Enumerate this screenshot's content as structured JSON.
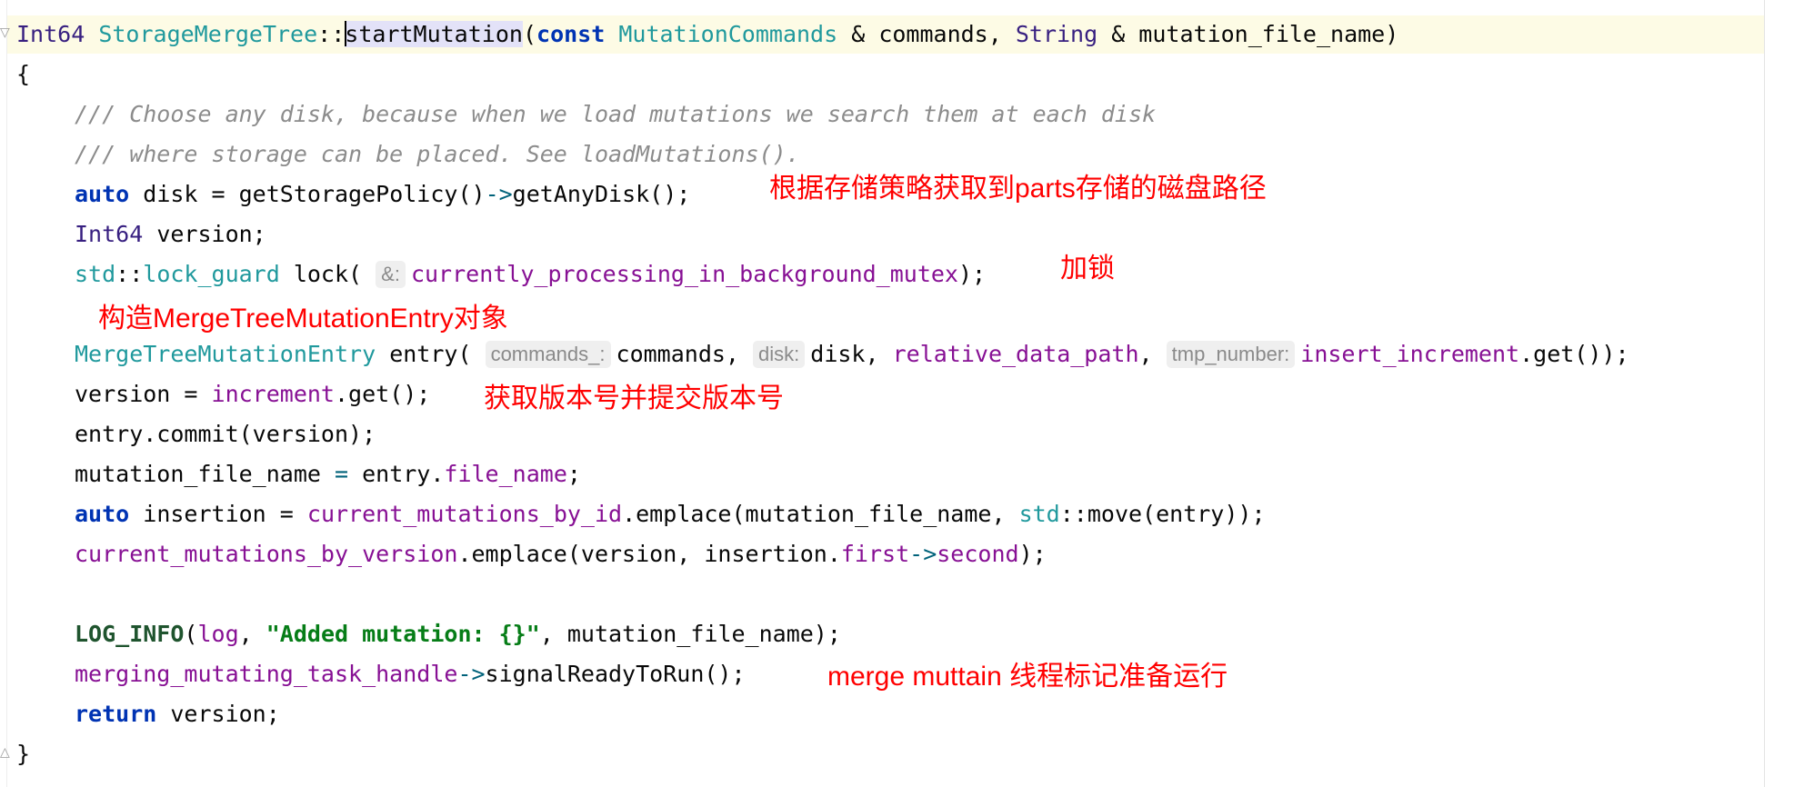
{
  "code": {
    "sig_ret_type": "Int64",
    "sig_class": "StorageMergeTree",
    "sig_scope": "::",
    "sig_fn_first": "s",
    "sig_fn_rest": "tartMutation",
    "sig_open": "(",
    "sig_const": "const",
    "sig_param_type": "MutationCommands",
    "sig_p1": " & commands, ",
    "sig_string_type": "String",
    "sig_p2": " & mutation_file_name)",
    "brace_open": "{",
    "comment_1": "/// Choose any disk, because when we load mutations we search them at each disk",
    "comment_2": "/// where storage can be placed. See loadMutations().",
    "l_disk_auto": "auto",
    "l_disk_mid": " disk = getStoragePolicy()",
    "l_disk_arrow": "->",
    "l_disk_end": "getAnyDisk();",
    "l_ver_type": "Int64",
    "l_ver_rest": " version;",
    "l_lock_std": "std",
    "l_lock_sep": "::",
    "l_lock_type": "lock_guard",
    "l_lock_mid": " lock( ",
    "l_lock_hint": "&:",
    "l_lock_mem": "currently_processing_in_background_mutex",
    "l_lock_end": ");",
    "l_entry_type": "MergeTreeMutationEntry",
    "l_entry_mid": " entry( ",
    "l_entry_hint1": "commands_:",
    "l_entry_a1": "commands, ",
    "l_entry_hint2": "disk:",
    "l_entry_a2": "disk, ",
    "l_entry_mem1": "relative_data_path",
    "l_entry_a3": ", ",
    "l_entry_hint3": "tmp_number:",
    "l_entry_mem2": "insert_increment",
    "l_entry_end": ".get());",
    "l_version_start": "version = ",
    "l_version_mem": "increment",
    "l_version_end": ".get();",
    "l_commit": "entry.commit(version);",
    "l_mfn_start": "mutation_file_name ",
    "l_mfn_eq": "=",
    "l_mfn_mid": " entry.",
    "l_mfn_mem": "file_name",
    "l_mfn_end": ";",
    "l_ins_auto": "auto",
    "l_ins_mid": " insertion = ",
    "l_ins_mem": "current_mutations_by_id",
    "l_ins_call": ".emplace(mutation_file_name, ",
    "l_ins_std": "std",
    "l_ins_end": "::move(entry));",
    "l_cmv_mem": "current_mutations_by_version",
    "l_cmv_mid": ".emplace(version, insertion.",
    "l_cmv_first": "first",
    "l_cmv_arrow": "->",
    "l_cmv_second": "second",
    "l_cmv_end": ");",
    "l_log_macro": "LOG_INFO",
    "l_log_open": "(",
    "l_log_mem": "log",
    "l_log_sep": ", ",
    "l_log_str": "\"Added mutation: {}\"",
    "l_log_end": ", mutation_file_name);",
    "l_sig_mem": "merging_mutating_task_handle",
    "l_sig_arrow": "->",
    "l_sig_end": "signalReadyToRun();",
    "l_ret_kw": "return",
    "l_ret_end": " version;",
    "brace_close": "}"
  },
  "annotations": {
    "disk_note": "根据存储策略获取到parts存储的磁盘路径",
    "lock_note": "加锁",
    "entry_note": "构造MergeTreeMutationEntry对象",
    "version_note": "获取版本号并提交版本号",
    "thread_note": "merge muttain 线程标记准备运行"
  },
  "colors": {
    "annotation": "#ff0000",
    "keyword": "#0033b3",
    "type": "#20999d",
    "member": "#871094",
    "comment": "#8c8c8c",
    "string": "#067d17"
  }
}
